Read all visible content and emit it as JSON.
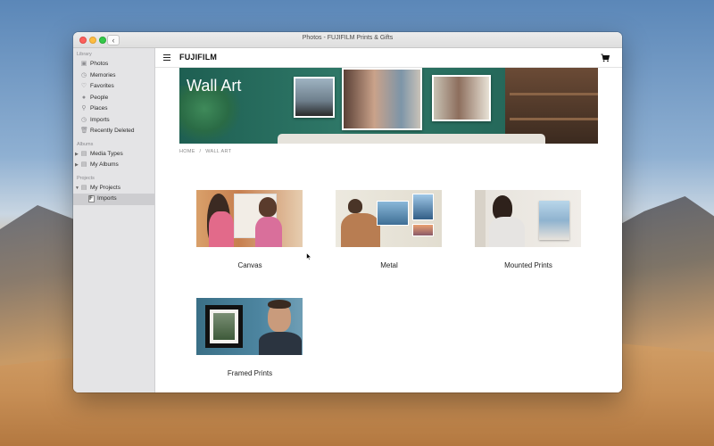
{
  "window": {
    "title": "Photos - FUJIFILM Prints & Gifts"
  },
  "sidebar": {
    "sections": [
      {
        "label": "Library",
        "items": [
          {
            "label": "Photos",
            "icon": "photos-icon"
          },
          {
            "label": "Memories",
            "icon": "memories-icon"
          },
          {
            "label": "Favorites",
            "icon": "heart-icon"
          },
          {
            "label": "People",
            "icon": "person-icon"
          },
          {
            "label": "Places",
            "icon": "pin-icon"
          },
          {
            "label": "Imports",
            "icon": "clock-icon"
          },
          {
            "label": "Recently Deleted",
            "icon": "trash-icon"
          }
        ]
      },
      {
        "label": "Albums",
        "items": [
          {
            "label": "Media Types",
            "icon": "folder-icon"
          },
          {
            "label": "My Albums",
            "icon": "folder-icon"
          }
        ]
      },
      {
        "label": "Projects",
        "items": [
          {
            "label": "My Projects",
            "icon": "folder-icon"
          },
          {
            "label": "Imports",
            "icon": "fujifilm-f-icon",
            "selected": true
          }
        ]
      }
    ]
  },
  "header": {
    "logo": "FUJIFILM",
    "menu_icon": "hamburger-icon",
    "cart_icon": "cart-icon"
  },
  "hero": {
    "title": "Wall Art"
  },
  "breadcrumb": {
    "home": "HOME",
    "separator": "/",
    "current": "WALL ART"
  },
  "products": [
    {
      "label": "Canvas"
    },
    {
      "label": "Metal"
    },
    {
      "label": "Mounted Prints"
    },
    {
      "label": "Framed Prints"
    }
  ],
  "colors": {
    "hero_wall": "#2d6e60",
    "sidebar_bg": "#e4e4e6",
    "selected_row": "#cdcdd0"
  }
}
